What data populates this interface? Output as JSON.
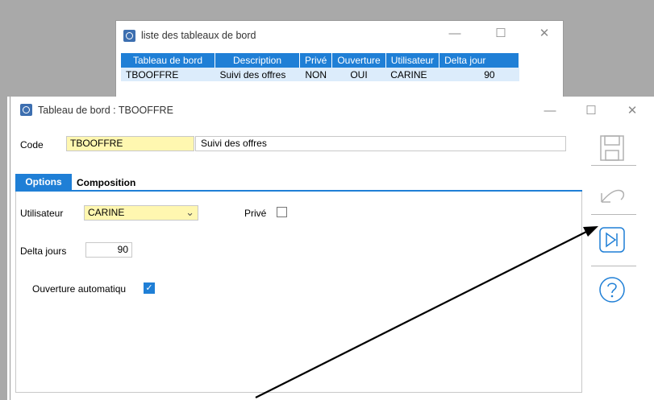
{
  "list_window": {
    "title": "liste des tableaux de bord",
    "columns": [
      "Tableau de bord",
      "Description",
      "Privé",
      "Ouverture",
      "Utilisateur",
      "Delta jour"
    ],
    "rows": [
      [
        "TBOOFFRE",
        "Suivi des offres",
        "NON",
        "OUI",
        "CARINE",
        "90"
      ]
    ]
  },
  "dashboard_window": {
    "title": "Tableau de bord : TBOOFFRE",
    "code_label": "Code",
    "code_value": "TBOOFFRE",
    "description_value": "Suivi des offres",
    "tabs": [
      {
        "label": "Options",
        "active": true
      },
      {
        "label": "Composition",
        "active": false
      }
    ],
    "options": {
      "utilisateur_label": "Utilisateur",
      "utilisateur_value": "CARINE",
      "prive_label": "Privé",
      "prive_checked": false,
      "delta_label": "Delta jours",
      "delta_value": "90",
      "ouverture_label": "Ouverture automatiqu",
      "ouverture_checked": true
    }
  },
  "toolbar": {
    "icons": [
      "save-icon",
      "undo-icon",
      "skip-forward-icon",
      "help-icon"
    ]
  },
  "colors": {
    "accent": "#1f7fd6",
    "highlight_field": "#fff7b0",
    "row_selected": "#dcecfb",
    "background_gray": "#a9a9a9"
  }
}
